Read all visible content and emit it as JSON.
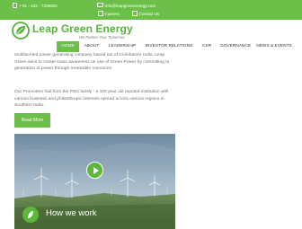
{
  "topbar": {
    "phone": "+ 91 - 422 - 7209500",
    "email": "info@leapgreenenergy.com",
    "careers": "Careers",
    "contact": "Contact Us"
  },
  "brand": {
    "name": "Leap Green Energy",
    "tagline": "We Partner Your Tomorrow"
  },
  "nav": {
    "items": [
      {
        "label": "HOME",
        "active": true
      },
      {
        "label": "ABOUT"
      },
      {
        "label": "LEADERSHIP"
      },
      {
        "label": "INVESTOR RELATIONS"
      },
      {
        "label": "CSR"
      },
      {
        "label": "GOVERNANCE"
      },
      {
        "label": "NEWS & EVENTS"
      }
    ]
  },
  "content": {
    "paragraph1": "multifaceted power generating company based out of Coimbatore India. Leap Green aims to create mass awareness on use of Green Power by committing to generation of power through renewable resources.",
    "paragraph2": "Our Promoters hail from the PSG family - a 100 year old reputed institution with various business and philanthropic interests spread across various regions in Southern India.",
    "read_more": "Read More",
    "how_we_work": "How we work"
  },
  "colors": {
    "brand_green": "#6cc04a",
    "logo_green": "#57b33a"
  },
  "icons": [
    "phone-icon",
    "mail-icon",
    "careers-icon",
    "contact-icon",
    "logo-leaf-icon",
    "play-icon",
    "leaf-icon"
  ]
}
